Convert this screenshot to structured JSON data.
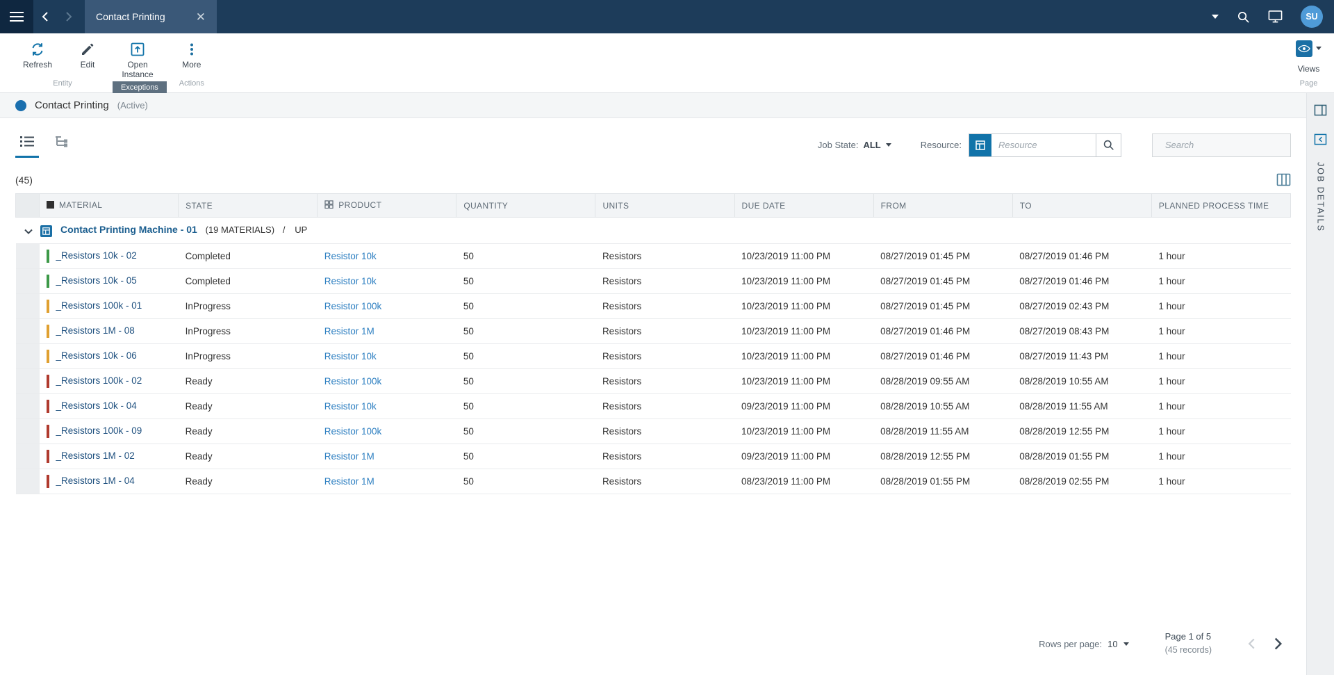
{
  "topbar": {
    "tab_title": "Contact Printing",
    "avatar_initials": "SU"
  },
  "toolbar": {
    "refresh_label": "Refresh",
    "edit_label": "Edit",
    "open_instance_label": "Open Instance",
    "more_label": "More",
    "group_entity": "Entity",
    "group_exceptions": "Exceptions",
    "group_actions": "Actions",
    "views_label": "Views",
    "page_label": "Page"
  },
  "page_header": {
    "title": "Contact Printing",
    "status": "(Active)"
  },
  "filters": {
    "job_state_label": "Job State:",
    "job_state_value": "ALL",
    "resource_label": "Resource:",
    "resource_placeholder": "Resource",
    "search_placeholder": "Search"
  },
  "table": {
    "count": "(45)",
    "columns": [
      "MATERIAL",
      "STATE",
      "PRODUCT",
      "QUANTITY",
      "UNITS",
      "DUE DATE",
      "FROM",
      "TO",
      "PLANNED PROCESS TIME"
    ],
    "group": {
      "name": "Contact Printing Machine - 01",
      "materials": "(19 MATERIALS)",
      "separator": "/",
      "state": "UP"
    },
    "rows": [
      {
        "material": "_Resistors 10k - 02",
        "state": "Completed",
        "product": "Resistor 10k",
        "quantity": "50",
        "units": "Resistors",
        "due_date": "10/23/2019 11:00 PM",
        "from": "08/27/2019 01:45 PM",
        "to": "08/27/2019 01:46 PM",
        "planned": "1 hour",
        "status": "completed"
      },
      {
        "material": "_Resistors 10k - 05",
        "state": "Completed",
        "product": "Resistor 10k",
        "quantity": "50",
        "units": "Resistors",
        "due_date": "10/23/2019 11:00 PM",
        "from": "08/27/2019 01:45 PM",
        "to": "08/27/2019 01:46 PM",
        "planned": "1 hour",
        "status": "completed"
      },
      {
        "material": "_Resistors 100k - 01",
        "state": "InProgress",
        "product": "Resistor 100k",
        "quantity": "50",
        "units": "Resistors",
        "due_date": "10/23/2019 11:00 PM",
        "from": "08/27/2019 01:45 PM",
        "to": "08/27/2019 02:43 PM",
        "planned": "1 hour",
        "status": "inprogress"
      },
      {
        "material": "_Resistors 1M - 08",
        "state": "InProgress",
        "product": "Resistor 1M",
        "quantity": "50",
        "units": "Resistors",
        "due_date": "10/23/2019 11:00 PM",
        "from": "08/27/2019 01:46 PM",
        "to": "08/27/2019 08:43 PM",
        "planned": "1 hour",
        "status": "inprogress"
      },
      {
        "material": "_Resistors 10k - 06",
        "state": "InProgress",
        "product": "Resistor 10k",
        "quantity": "50",
        "units": "Resistors",
        "due_date": "10/23/2019 11:00 PM",
        "from": "08/27/2019 01:46 PM",
        "to": "08/27/2019 11:43 PM",
        "planned": "1 hour",
        "status": "inprogress"
      },
      {
        "material": "_Resistors 100k - 02",
        "state": "Ready",
        "product": "Resistor 100k",
        "quantity": "50",
        "units": "Resistors",
        "due_date": "10/23/2019 11:00 PM",
        "from": "08/28/2019 09:55 AM",
        "to": "08/28/2019 10:55 AM",
        "planned": "1 hour",
        "status": "ready"
      },
      {
        "material": "_Resistors 10k - 04",
        "state": "Ready",
        "product": "Resistor 10k",
        "quantity": "50",
        "units": "Resistors",
        "due_date": "09/23/2019 11:00 PM",
        "from": "08/28/2019 10:55 AM",
        "to": "08/28/2019 11:55 AM",
        "planned": "1 hour",
        "status": "ready"
      },
      {
        "material": "_Resistors 100k - 09",
        "state": "Ready",
        "product": "Resistor 100k",
        "quantity": "50",
        "units": "Resistors",
        "due_date": "10/23/2019 11:00 PM",
        "from": "08/28/2019 11:55 AM",
        "to": "08/28/2019 12:55 PM",
        "planned": "1 hour",
        "status": "ready"
      },
      {
        "material": "_Resistors 1M - 02",
        "state": "Ready",
        "product": "Resistor 1M",
        "quantity": "50",
        "units": "Resistors",
        "due_date": "09/23/2019 11:00 PM",
        "from": "08/28/2019 12:55 PM",
        "to": "08/28/2019 01:55 PM",
        "planned": "1 hour",
        "status": "ready"
      },
      {
        "material": "_Resistors 1M - 04",
        "state": "Ready",
        "product": "Resistor 1M",
        "quantity": "50",
        "units": "Resistors",
        "due_date": "08/23/2019 11:00 PM",
        "from": "08/28/2019 01:55 PM",
        "to": "08/28/2019 02:55 PM",
        "planned": "1 hour",
        "status": "ready"
      }
    ]
  },
  "footer": {
    "rows_per_page_label": "Rows per page:",
    "rows_per_page_value": "10",
    "page_info": "Page 1 of 5",
    "records_info": "(45 records)"
  },
  "side_panel": {
    "title": "JOB DETAILS"
  },
  "colors": {
    "accent": "#1173a9",
    "topbar": "#1d3c5a",
    "link": "#2d7fc1",
    "material_link": "#1d4f7e",
    "status_completed": "#3d9948",
    "status_inprogress": "#e0a030",
    "status_ready": "#b03a2e"
  }
}
